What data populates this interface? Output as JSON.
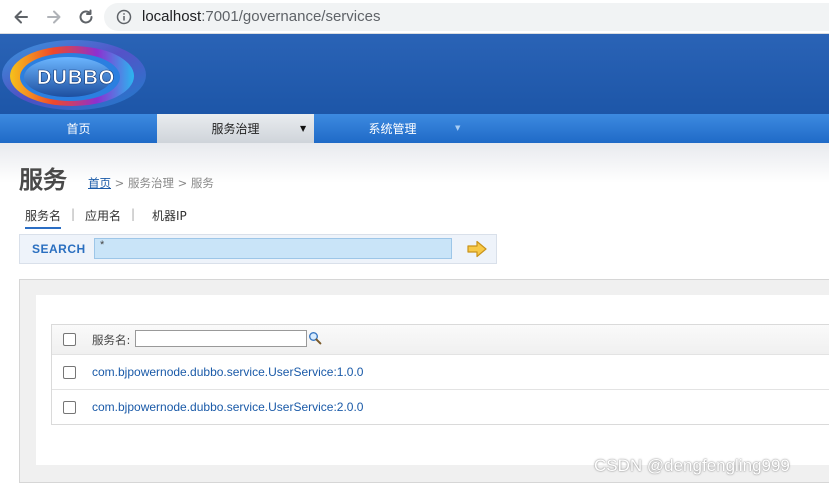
{
  "browser": {
    "url_host": "localhost",
    "url_path": ":7001/governance/services"
  },
  "brand": {
    "logo_text": "DUBBO"
  },
  "nav": {
    "items": [
      {
        "label": "首页",
        "active": false
      },
      {
        "label": "服务治理",
        "active": true,
        "caret": "▼"
      },
      {
        "label": "系统管理",
        "active": false,
        "caret": "▼"
      }
    ]
  },
  "page": {
    "title": "服务",
    "breadcrumb": {
      "home": "首页",
      "sep1": " > ",
      "section": "服务治理",
      "sep2": " > ",
      "current": "服务"
    }
  },
  "tabs": {
    "items": [
      "服务名",
      "应用名",
      "机器IP"
    ],
    "separator": "|"
  },
  "search": {
    "label": "SEARCH",
    "value": "*"
  },
  "table": {
    "filter_label": "服务名:",
    "filter_value": "",
    "rows": [
      "com.bjpowernode.dubbo.service.UserService:1.0.0",
      "com.bjpowernode.dubbo.service.UserService:2.0.0"
    ]
  },
  "watermark": "CSDN @dengfengling999",
  "colors": {
    "header_blue": "#1d56a8",
    "nav_blue": "#2b78d4",
    "link": "#1a5aa8",
    "search_accent": "#2a6fc0"
  }
}
